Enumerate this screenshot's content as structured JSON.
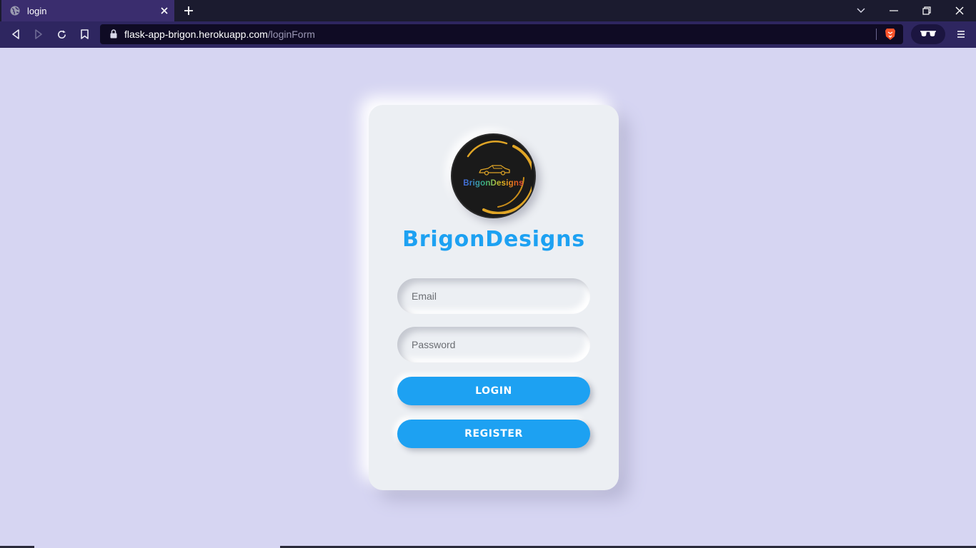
{
  "browser": {
    "tab_title": "login",
    "url_host": "flask-app-brigon.herokuapp.com",
    "url_path": "/loginForm"
  },
  "page": {
    "logo_text": "BrigonDesigns",
    "brand_title": "BrigonDesigns",
    "email_placeholder": "Email",
    "password_placeholder": "Password",
    "login_label": "LOGIN",
    "register_label": "REGISTER"
  },
  "colors": {
    "page_bg": "#d6d5f2",
    "card_bg": "#eceff3",
    "accent": "#1da1f2",
    "logo_ring": "#e0a526"
  },
  "icons": [
    "globe-icon",
    "close-icon",
    "plus-icon",
    "chevron-down-icon",
    "minimize-icon",
    "restore-icon",
    "back-icon",
    "forward-icon",
    "reload-icon",
    "bookmark-icon",
    "lock-icon",
    "brave-shield-icon",
    "sunglasses-icon",
    "menu-icon",
    "car-icon"
  ]
}
